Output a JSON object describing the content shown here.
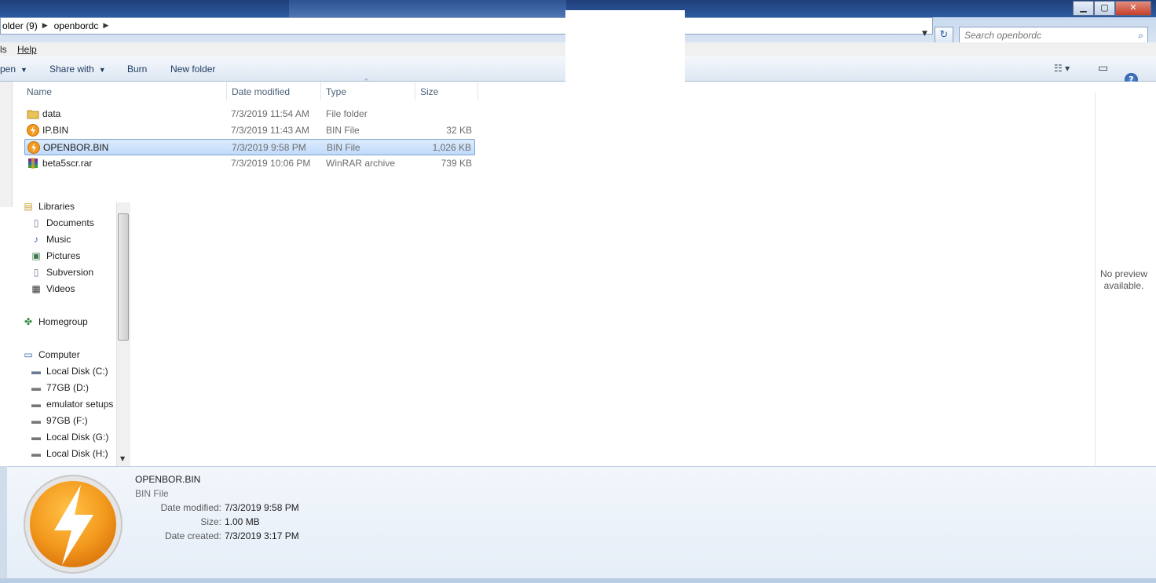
{
  "window": {
    "min_label": "▁",
    "max_label": "▢",
    "close_label": "✕"
  },
  "address": {
    "crumbs": [
      "older (9)",
      "openbordc"
    ],
    "search_placeholder": "Search openbordc"
  },
  "menu": {
    "items": [
      "ls",
      "Help"
    ]
  },
  "toolbar": {
    "open_label": "pen",
    "share_label": "Share with",
    "burn_label": "Burn",
    "new_folder_label": "New folder"
  },
  "columns": {
    "name": "Name",
    "date": "Date modified",
    "type": "Type",
    "size": "Size"
  },
  "files": [
    {
      "name": "data",
      "date": "7/3/2019 11:54 AM",
      "type": "File folder",
      "size": "",
      "icon": "folder-icon"
    },
    {
      "name": "IP.BIN",
      "date": "7/3/2019 11:43 AM",
      "type": "BIN File",
      "size": "32 KB",
      "icon": "bin-file-icon"
    },
    {
      "name": "OPENBOR.BIN",
      "date": "7/3/2019 9:58 PM",
      "type": "BIN File",
      "size": "1,026 KB",
      "icon": "bin-file-icon",
      "selected": true
    },
    {
      "name": "beta5scr.rar",
      "date": "7/3/2019 10:06 PM",
      "type": "WinRAR archive",
      "size": "739 KB",
      "icon": "winrar-icon"
    }
  ],
  "nav": {
    "libraries": "Libraries",
    "documents": "Documents",
    "music": "Music",
    "pictures": "Pictures",
    "subversion": "Subversion",
    "videos": "Videos",
    "homegroup": "Homegroup",
    "computer": "Computer",
    "drive_c": "Local Disk (C:)",
    "drive_d": "77GB (D:)",
    "drive_e": "emulator setups",
    "drive_f": "97GB (F:)",
    "drive_g": "Local Disk (G:)",
    "drive_h": "Local Disk (H:)"
  },
  "preview": {
    "line1": "No preview",
    "line2": "available."
  },
  "details": {
    "name": "OPENBOR.BIN",
    "type": "BIN File",
    "date_modified_label": "Date modified:",
    "date_modified": "7/3/2019 9:58 PM",
    "size_label": "Size:",
    "size": "1.00 MB",
    "date_created_label": "Date created:",
    "date_created": "7/3/2019 3:17 PM"
  },
  "colors": {
    "accent": "#2e5fa8",
    "selection": "#c1dbfc",
    "bin_orange": "#f39a1e"
  }
}
